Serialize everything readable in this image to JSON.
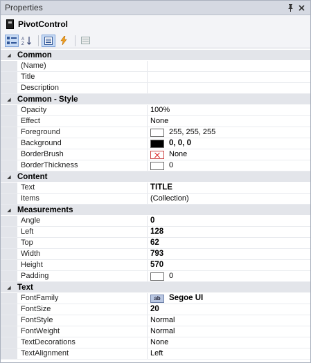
{
  "window": {
    "title": "Properties",
    "pin_glyph": "X",
    "close_glyph": "×"
  },
  "object": {
    "name": "PivotControl"
  },
  "categories": [
    {
      "name": "Common",
      "props": [
        {
          "name": "(Name)",
          "value": ""
        },
        {
          "name": "Title",
          "value": ""
        },
        {
          "name": "Description",
          "value": ""
        }
      ]
    },
    {
      "name": "Common - Style",
      "props": [
        {
          "name": "Opacity",
          "value": "100%"
        },
        {
          "name": "Effect",
          "value": "None"
        },
        {
          "name": "Foreground",
          "value": "255, 255, 255",
          "swatch": "#ffffff"
        },
        {
          "name": "Background",
          "value": "0, 0, 0",
          "swatch": "#000000",
          "bold": true
        },
        {
          "name": "BorderBrush",
          "value": "None",
          "swatch": "none"
        },
        {
          "name": "BorderThickness",
          "value": "0",
          "swatch": "#ffffff"
        }
      ]
    },
    {
      "name": "Content",
      "props": [
        {
          "name": "Text",
          "value": "TITLE",
          "bold": true
        },
        {
          "name": "Items",
          "value": "(Collection)"
        }
      ]
    },
    {
      "name": "Measurements",
      "props": [
        {
          "name": "Angle",
          "value": "0",
          "bold": true
        },
        {
          "name": "Left",
          "value": "128",
          "bold": true
        },
        {
          "name": "Top",
          "value": "62",
          "bold": true
        },
        {
          "name": "Width",
          "value": "793",
          "bold": true
        },
        {
          "name": "Height",
          "value": "570",
          "bold": true
        },
        {
          "name": "Padding",
          "value": "0",
          "swatch": "#ffffff"
        }
      ]
    },
    {
      "name": "Text",
      "props": [
        {
          "name": "FontFamily",
          "value": "Segoe UI",
          "bold": true,
          "fonticon": "ab"
        },
        {
          "name": "FontSize",
          "value": "20",
          "bold": true
        },
        {
          "name": "FontStyle",
          "value": "Normal"
        },
        {
          "name": "FontWeight",
          "value": "Normal"
        },
        {
          "name": "TextDecorations",
          "value": "None"
        },
        {
          "name": "TextAlignment",
          "value": "Left"
        }
      ]
    }
  ]
}
